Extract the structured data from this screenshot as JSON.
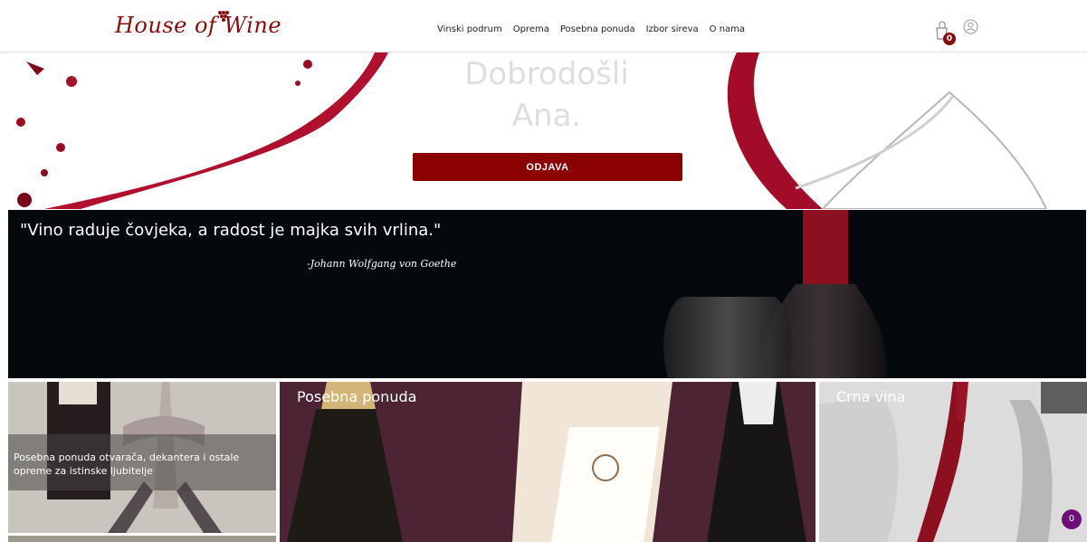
{
  "header": {
    "logo_text": "House of Wine",
    "nav": [
      "Vinski podrum",
      "Oprema",
      "Posebna ponuda",
      "Izbor sireva",
      "O nama"
    ],
    "cart_count": "0"
  },
  "hero": {
    "line1": "Dobrodošli",
    "line2": "Ana.",
    "logout_label": "ODJAVA"
  },
  "quote": {
    "text": "\"Vino raduje čovjeka, a radost je majka svih vrlina.\"",
    "author": "-Johann Wolfgang von Goethe"
  },
  "tiles": {
    "equipment_caption": "Posebna ponuda otvarača, dekantera i ostale opreme za istinske ljubitelje",
    "special_offer_title": "Posebna ponuda",
    "red_wines_title": "Crna vina"
  },
  "chat_badge": "0",
  "colors": {
    "brand": "#8a0b0b",
    "button": "#8b0000",
    "quote_band": "#05080c",
    "chat": "#6d0f76"
  }
}
